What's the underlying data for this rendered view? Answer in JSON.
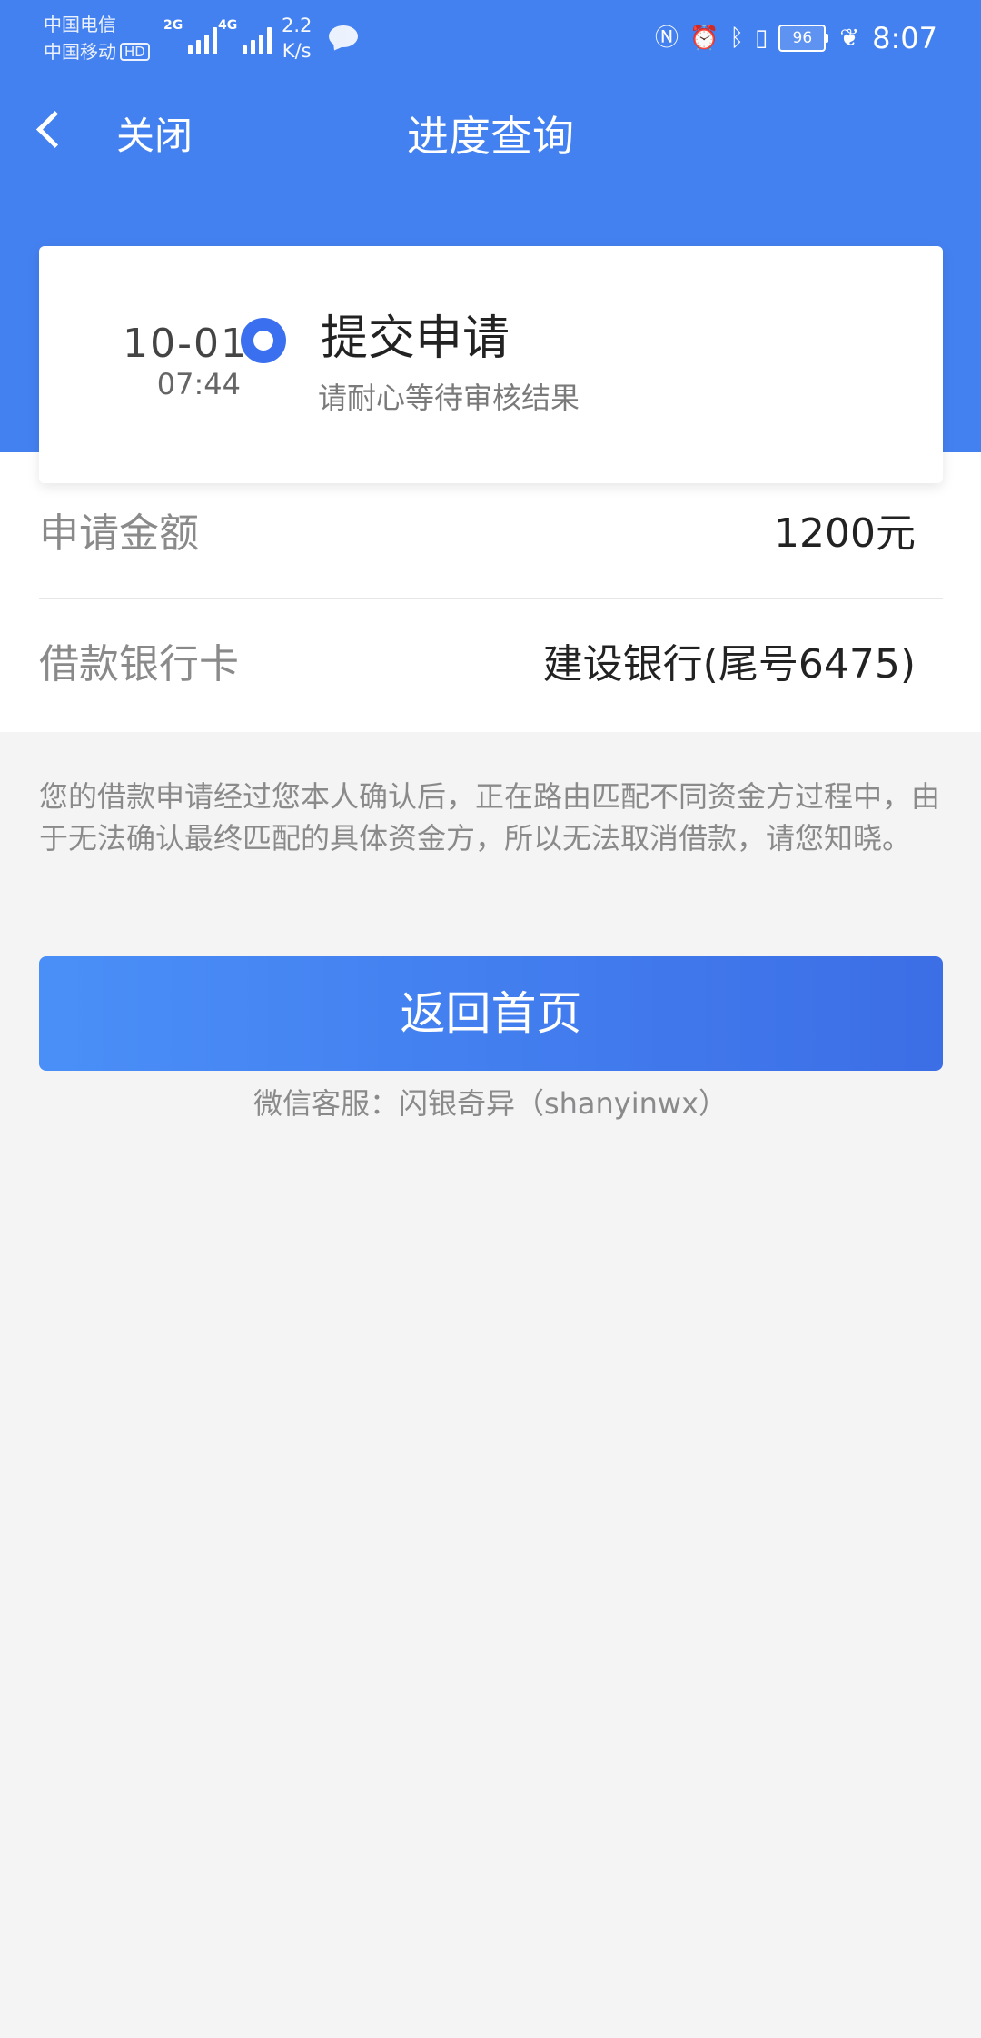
{
  "status_bar": {
    "carrier_1": "中国电信",
    "carrier_2": "中国移动",
    "hd_badge": "HD",
    "network_1": "2G",
    "network_2": "4G",
    "speed_value": "2.2",
    "speed_unit": "K/s",
    "battery": "96",
    "time": "8:07",
    "icons": [
      "chat-icon",
      "nfc-icon",
      "alarm-icon",
      "bluetooth-icon",
      "vibrate-icon",
      "leaf-icon"
    ]
  },
  "nav": {
    "close_label": "关闭",
    "title": "进度查询"
  },
  "progress": {
    "date": "10-01",
    "time": "07:44",
    "step_title": "提交申请",
    "step_subtitle": "请耐心等待审核结果"
  },
  "details": {
    "amount_label": "申请金额",
    "amount_value": "1200元",
    "card_label": "借款银行卡",
    "card_value": "建设银行(尾号6475)"
  },
  "notice": "您的借款申请经过您本人确认后，正在路由匹配不同资金方过程中，由于无法确认最终匹配的具体资金方，所以无法取消借款，请您知晓。",
  "actions": {
    "home_button": "返回首页"
  },
  "service": "微信客服：闪银奇异（shanyinwx）",
  "colors": {
    "header": "#4481f0",
    "accent": "#3a6ff0",
    "background": "#f4f4f5"
  }
}
